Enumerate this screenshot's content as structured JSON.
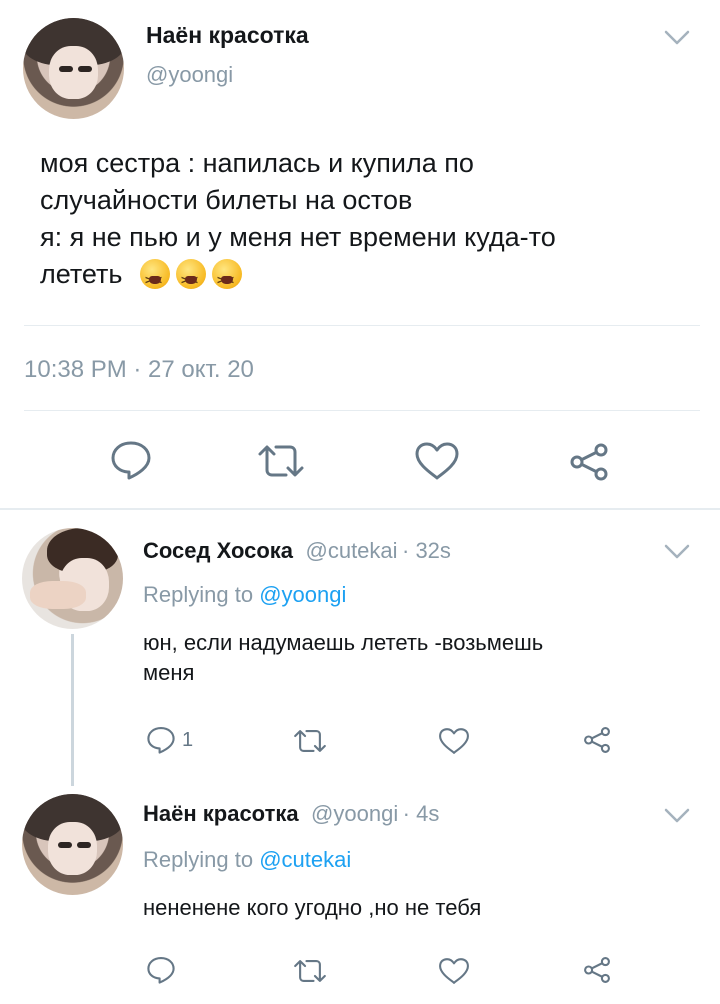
{
  "main_tweet": {
    "name": "Наён красотка",
    "handle": "@yoongi",
    "text_lines": [
      "моя сестра : напилась и купила по",
      "случайности билеты на остов",
      "я: я не пью и у меня нет времени куда-то",
      "лететь"
    ],
    "emoji_name": "tired-face-emoji",
    "timestamp": "10:38 PM · 27 окт. 20",
    "actions": [
      "reply-icon",
      "retweet-icon",
      "like-icon",
      "share-icon"
    ]
  },
  "reply1": {
    "name": "Сосед Хосока",
    "handle": "@cutekai",
    "time": "· 32s",
    "replying_prefix": "Replying to",
    "replying_to": "@yoongi",
    "text_lines": [
      "юн, если надумаешь лететь -возьмешь",
      "меня"
    ],
    "reply_count": "1"
  },
  "reply2": {
    "name": "Наён красотка",
    "handle": "@yoongi",
    "time": "· 4s",
    "replying_prefix": "Replying to",
    "replying_to": "@cutekai",
    "text_lines": [
      "нененене кого угодно ,но не тебя"
    ]
  },
  "colors": {
    "accent": "#1da1f2",
    "muted": "#8899a6",
    "text": "#14171a",
    "divider": "#e6ecf0"
  }
}
